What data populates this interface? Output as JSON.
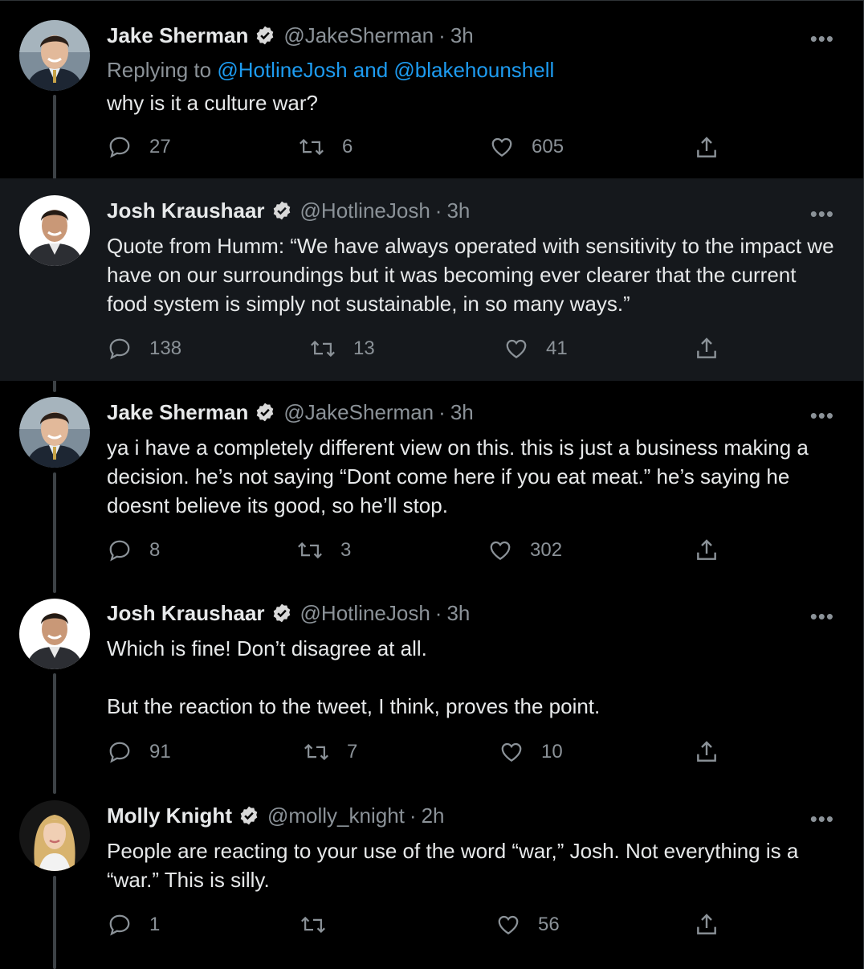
{
  "tweets": [
    {
      "name": "Jake Sherman",
      "handle": "@JakeSherman",
      "time": "3h",
      "reply_prefix": "Replying to ",
      "reply_links": "@HotlineJosh and @blakehounshell",
      "text": "why is it a culture war?",
      "replies": "27",
      "retweets": "6",
      "likes": "605"
    },
    {
      "name": "Josh Kraushaar",
      "handle": "@HotlineJosh",
      "time": "3h",
      "text": "Quote from Humm: “We have always operated with sensitivity to the impact we have on our surroundings but it was becoming ever clearer that the current food system is simply not sustainable, in so many ways.”",
      "replies": "138",
      "retweets": "13",
      "likes": "41"
    },
    {
      "name": "Jake Sherman",
      "handle": "@JakeSherman",
      "time": "3h",
      "text": "ya i have a completely different view on this. this is just a business making a decision. he’s not saying “Dont come here if you eat meat.” he’s saying he doesnt believe its good, so he’ll stop.",
      "replies": "8",
      "retweets": "3",
      "likes": "302"
    },
    {
      "name": "Josh Kraushaar",
      "handle": "@HotlineJosh",
      "time": "3h",
      "text": "Which is fine! Don’t disagree at all.\n\nBut the reaction to the tweet, I think, proves the point.",
      "replies": "91",
      "retweets": "7",
      "likes": "10"
    },
    {
      "name": "Molly Knight",
      "handle": "@molly_knight",
      "time": "2h",
      "text": "People are reacting to your use of the word “war,” Josh. Not everything is a “war.” This is silly.",
      "replies": "1",
      "retweets": "",
      "likes": "56"
    }
  ],
  "ui": {
    "dot": "·",
    "more": "•••"
  },
  "colors": {
    "background": "#000000",
    "highlight": "#15181c",
    "link": "#1d9bf0",
    "muted": "#8b9298",
    "text": "#e7e9ea"
  },
  "icons": [
    "verified-badge-icon",
    "reply-icon",
    "retweet-icon",
    "like-icon",
    "share-icon",
    "more-icon"
  ]
}
